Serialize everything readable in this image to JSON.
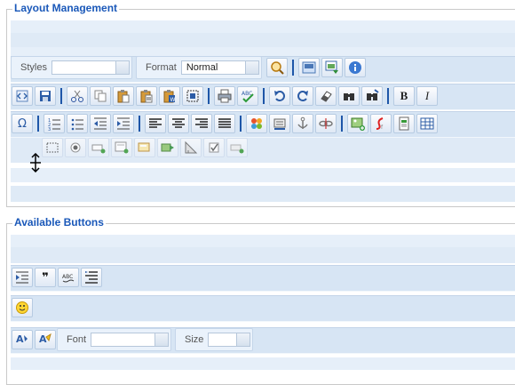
{
  "layout": {
    "title": "Layout Management",
    "toolbar1": {
      "styles_label": "Styles",
      "styles_value": "",
      "format_label": "Format",
      "format_value": "Normal",
      "icons": [
        "zoom-icon",
        "show-blocks-icon",
        "maximize-icon",
        "about-icon"
      ]
    },
    "toolbar2": {
      "icons": [
        "source-icon",
        "save-icon",
        "cut-icon",
        "copy-icon",
        "paste-icon",
        "paste-text-icon",
        "paste-word-icon",
        "select-all-icon",
        "print-icon",
        "spellcheck-icon",
        "undo-icon",
        "redo-icon",
        "remove-format-icon",
        "find-icon",
        "replace-icon",
        "bold-icon",
        "italic-icon"
      ],
      "bold_glyph": "B",
      "italic_glyph": "I"
    },
    "toolbar3": {
      "icons": [
        "special-char-icon",
        "numbered-list-icon",
        "bulleted-list-icon",
        "outdent-icon",
        "indent-icon",
        "align-left-icon",
        "align-center-icon",
        "align-right-icon",
        "justify-icon",
        "joomla-plugin-icon",
        "read-more-icon",
        "anchor-icon",
        "unlink-icon",
        "image-icon",
        "flash-icon",
        "template-icon",
        "table-icon"
      ],
      "omega_glyph": "Ω"
    },
    "drag_ghost": {
      "icons": [
        "div-icon",
        "radio-icon",
        "textfield-icon",
        "textarea-icon",
        "select-icon",
        "button-icon",
        "image-button-icon",
        "checkbox-icon",
        "hidden-field-icon"
      ]
    }
  },
  "available": {
    "title": "Available Buttons",
    "row1": {
      "icons": [
        "blockquote-icon",
        "quote-icon",
        "spell-icon",
        "bidi-icon"
      ],
      "quote_glyph": "❞"
    },
    "row2": {
      "icons": [
        "smiley-icon"
      ]
    },
    "row3": {
      "icons": [
        "text-color-icon",
        "bg-color-icon"
      ],
      "font_label": "Font",
      "font_value": "",
      "size_label": "Size",
      "size_value": ""
    }
  }
}
